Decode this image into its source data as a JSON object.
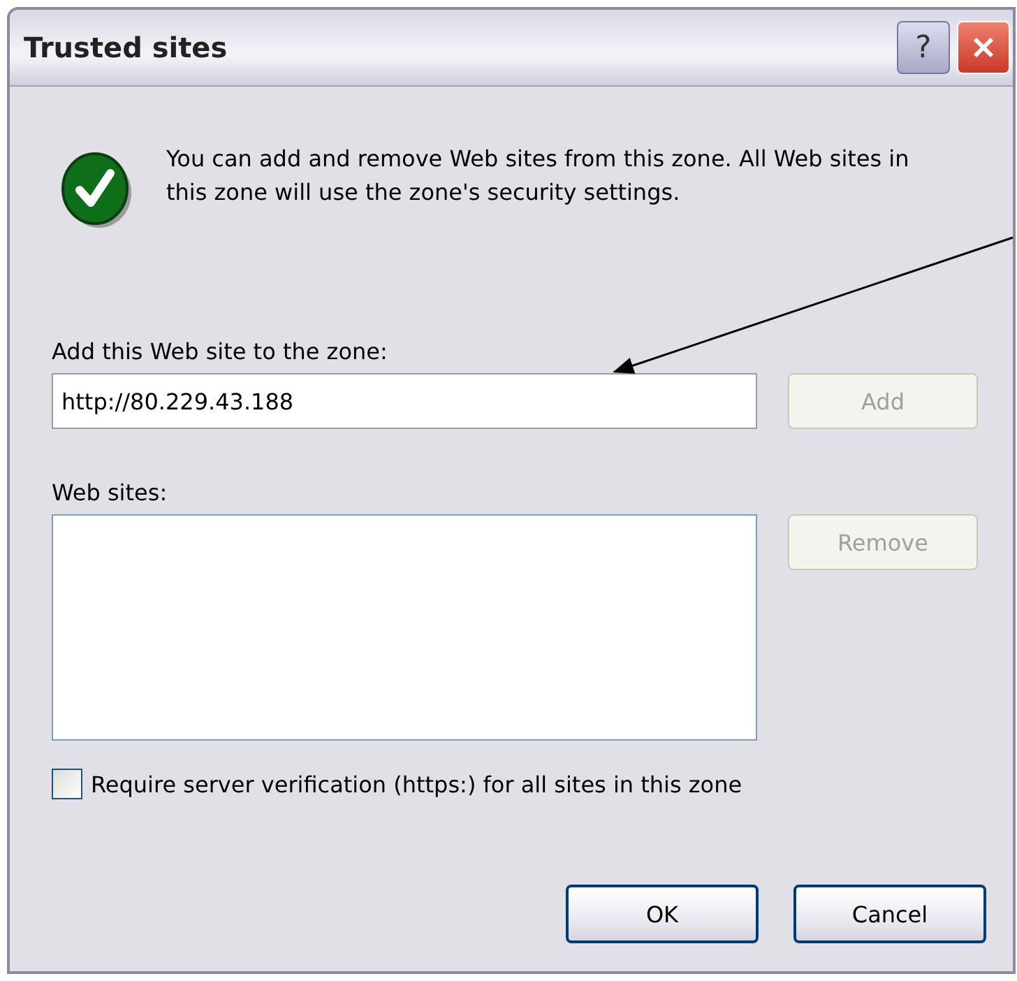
{
  "window": {
    "title": "Trusted sites",
    "title_buttons": [
      {
        "kind": "help",
        "label": "?"
      },
      {
        "kind": "close"
      }
    ]
  },
  "info": {
    "text": "You can add and remove Web sites from this zone. All Web sites in this zone will use the zone's security settings."
  },
  "add_site": {
    "label": "Add this Web site to the zone:",
    "value": "http://80.229.43.188",
    "button": {
      "label": "Add",
      "disabled": true
    }
  },
  "web_sites": {
    "label": "Web sites:",
    "button": {
      "label": "Remove",
      "disabled": true
    }
  },
  "require_https": {
    "label": "Require server verification (https:) for all sites in this zone",
    "checked": false
  },
  "buttons": [
    {
      "label": "OK",
      "disabled": false
    },
    {
      "label": "Cancel",
      "disabled": false
    }
  ]
}
